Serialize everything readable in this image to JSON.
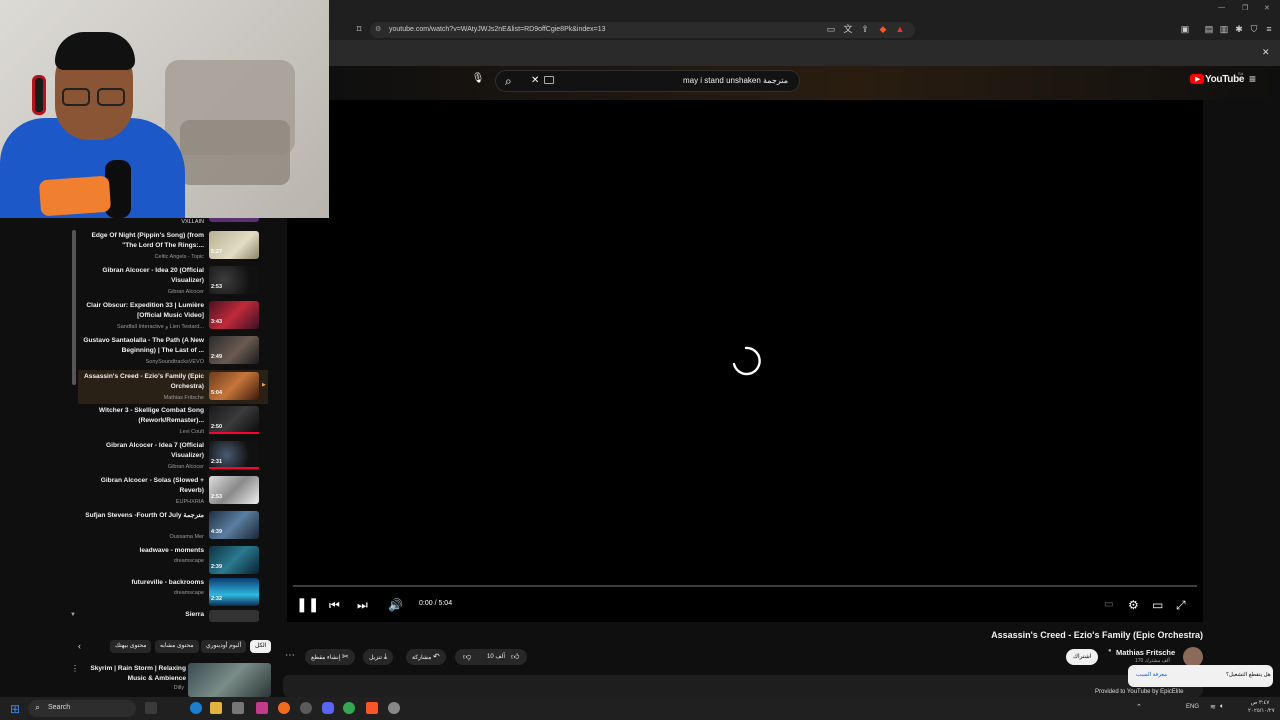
{
  "browser": {
    "url": "youtube.com/watch?v=WAtyJWJs2nE&list=RD9offCgie8Pk&index=13"
  },
  "youtube": {
    "logo_text": "YouTube",
    "logo_superscript": "SA",
    "search_value": "may i stand unshaken مترجمة",
    "player": {
      "time": "0:00 / 5:04",
      "state": "loading"
    },
    "video": {
      "title": "Assassin's Creed - Ezio's Family (Epic Orchestra)",
      "channel": "Mathias Fritsche",
      "subscribers": "170 ألف مشترك",
      "subscribe_label": "اشتراك",
      "like_count": "10 آلف",
      "share_label": "مشاركة",
      "download_label": "تنزيل",
      "clip_label": "إنشاء مقطع",
      "more_label": "...",
      "provided_by": "Provided to YouTube by EpicElite"
    },
    "playlist": {
      "items": [
        {
          "title": "VXLLAIN",
          "channel": "",
          "duration": "",
          "partial": true
        },
        {
          "title": "Edge Of Night (Pippin's Song) (from \"The Lord Of The Rings:...",
          "channel": "Celtic Angels - Topic",
          "duration": "5:27"
        },
        {
          "title": "Gibran Alcocer - Idea 20 (Official Visualizer)",
          "channel": "Gibran Alcocer",
          "duration": "2:53"
        },
        {
          "title": "Clair Obscur: Expedition 33 | Lumière [Official Music Video]",
          "channel": "Sandfall Interactive و Lien Testard...",
          "duration": "3:43"
        },
        {
          "title": "Gustavo Santaolalla - The Path (A New Beginning) | The Last of ...",
          "channel": "SonySoundtracksVEVO",
          "duration": "2:49"
        },
        {
          "title": "Assassin's Creed - Ezio's Family (Epic Orchestra)",
          "channel": "Mathias Fritsche",
          "duration": "5:04",
          "active": true
        },
        {
          "title": "Witcher 3 - Skellige Combat Song (Rework/Remaster)...",
          "channel": "Levi Coult",
          "duration": "2:50"
        },
        {
          "title": "Gibran Alcocer - Idea 7 (Official Visualizer)",
          "channel": "Gibran Alcocer",
          "duration": "2:31"
        },
        {
          "title": "Gibran Alcocer - Solas (Slowed + Reverb)",
          "channel": "EUPHXRIA",
          "duration": "2:53"
        },
        {
          "title": "Sufjan Stevens -Fourth Of July مترجمة",
          "channel": "Oussama Mer",
          "duration": "4:39"
        },
        {
          "title": "leadwave - moments",
          "channel": "dreamscape",
          "duration": "2:39"
        },
        {
          "title": "futureville - backrooms",
          "channel": "dreamscape",
          "duration": "2:32"
        },
        {
          "title": "Sierra",
          "channel": "",
          "duration": "",
          "partial": true
        }
      ]
    },
    "chips": [
      "الكل",
      "ألبوم أودينوري",
      "محتوى مشابه",
      "محتوى بيهتك"
    ],
    "recommended": {
      "title": "Skyrim | Rain Storm | Relaxing Music & Ambience",
      "channel": "Dilly"
    },
    "popup": {
      "question": "هل يتقطع التشغيل؟",
      "link": "معرفة السبب"
    }
  },
  "taskbar": {
    "search_placeholder": "Search",
    "language": "ENG",
    "time": "٣:٤٧ ص",
    "date": "٢٠٢٥/١٠/٢٧"
  }
}
